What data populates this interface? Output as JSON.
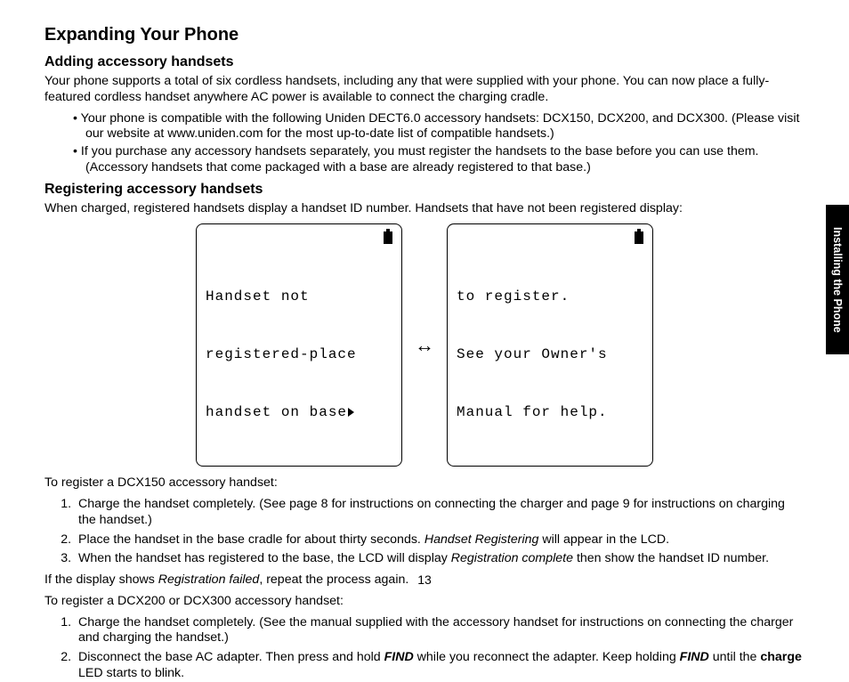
{
  "page_number": "13",
  "side_tab": "Installing the Phone",
  "title": "Expanding Your Phone",
  "s1": {
    "heading": "Adding accessory handsets",
    "p1": "Your phone supports a total of six cordless handsets, including any that were supplied with your phone. You can now place a fully-featured cordless handset anywhere AC power is available to connect the charging cradle.",
    "b1": "Your phone is compatible with the following Uniden DECT6.0 accessory handsets: DCX150, DCX200, and DCX300. (Please visit our website at www.uniden.com for the most up-to-date list of compatible handsets.)",
    "b2": "If you purchase any accessory handsets separately, you must register the handsets to the base before you can use them. (Accessory handsets that come packaged with a base are already registered to that base.)"
  },
  "s2": {
    "heading": "Registering accessory handsets",
    "p1": "When charged, registered handsets display a handset ID number. Handsets that have not been registered display:",
    "lcd1_l1": "Handset not",
    "lcd1_l2": "registered-place",
    "lcd1_l3": "handset on base",
    "lcd2_l1": "to register.",
    "lcd2_l2": "See your Owner's",
    "lcd2_l3": "Manual for help.",
    "p2": "To register a DCX150 accessory handset:",
    "ol1": {
      "i1": "Charge the handset completely. (See page 8 for instructions on connecting the charger and page 9 for instructions on charging the handset.)",
      "i2a": "Place the handset in the base cradle for about thirty seconds. ",
      "i2b": "Handset Registering",
      "i2c": " will appear in the LCD.",
      "i3a": "When the handset has registered to the base, the LCD will display ",
      "i3b": "Registration complete",
      "i3c": " then show the handset ID number."
    },
    "p3a": "If the display shows ",
    "p3b": "Registration failed",
    "p3c": ", repeat the process again.",
    "p4": "To register a DCX200 or DCX300 accessory handset:",
    "ol2": {
      "i1": "Charge the handset completely. (See the manual supplied with the accessory handset for instructions on connecting the charger and charging the handset.)",
      "i2a": "Disconnect the base AC adapter. Then press and hold ",
      "i2b": "FIND",
      "i2c": " while you reconnect the adapter. Keep holding ",
      "i2d": "FIND",
      "i2e": " until the ",
      "i2f": "charge",
      "i2g": " LED starts to blink."
    }
  }
}
